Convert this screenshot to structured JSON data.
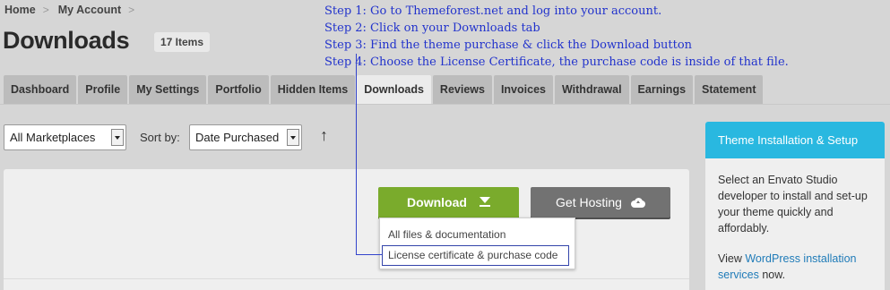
{
  "breadcrumb": {
    "items": [
      "Home",
      "My Account"
    ],
    "separator": ">"
  },
  "page": {
    "title": "Downloads",
    "count_badge": "17 Items"
  },
  "instructions": [
    "Step 1: Go to Themeforest.net and log into your account.",
    "Step 2: Click on your Downloads tab",
    "Step 3: Find the theme purchase & click the Download button",
    "Step 4: Choose the License Certificate, the purchase code is inside of that file."
  ],
  "tabs": [
    {
      "label": "Dashboard",
      "active": false
    },
    {
      "label": "Profile",
      "active": false
    },
    {
      "label": "My Settings",
      "active": false
    },
    {
      "label": "Portfolio",
      "active": false
    },
    {
      "label": "Hidden Items",
      "active": false
    },
    {
      "label": "Downloads",
      "active": true
    },
    {
      "label": "Reviews",
      "active": false
    },
    {
      "label": "Invoices",
      "active": false
    },
    {
      "label": "Withdrawal",
      "active": false
    },
    {
      "label": "Earnings",
      "active": false
    },
    {
      "label": "Statement",
      "active": false
    }
  ],
  "filters": {
    "marketplace_value": "All Marketplaces",
    "sort_label": "Sort by:",
    "sort_value": "Date Purchased",
    "sort_direction_icon": "arrow-up-icon"
  },
  "actions": {
    "download_label": "Download",
    "download_icon": "download-icon",
    "hosting_label": "Get Hosting",
    "hosting_icon": "cloud-upload-icon"
  },
  "download_menu": {
    "items": [
      "All files & documentation",
      "License certificate & purchase code"
    ]
  },
  "sidebar": {
    "title": "Theme Installation & Setup",
    "body": "Select an Envato Studio developer to install and set-up your theme quickly and affordably.",
    "link_prefix": "View",
    "link_text": "WordPress installation services",
    "link_suffix": "now."
  },
  "colors": {
    "accent_download": "#7aab2c",
    "hosting_button": "#727272",
    "sidebar_header": "#29b8e0",
    "annotation": "#2233cc"
  }
}
